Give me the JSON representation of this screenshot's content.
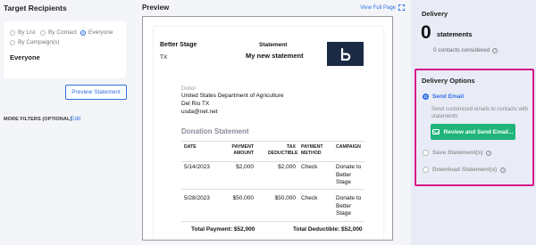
{
  "left": {
    "title": "Target Recipients",
    "radios": [
      {
        "label": "By List",
        "selected": false
      },
      {
        "label": "By Contact",
        "selected": false
      },
      {
        "label": "Everyone",
        "selected": true
      },
      {
        "label": "By Campaign(s)",
        "selected": false
      }
    ],
    "selected_value": "Everyone",
    "preview_button": "Preview Statement",
    "filters_label": "MORE FILTERS (OPTIONAL)",
    "filters_edit": "Edit"
  },
  "preview": {
    "title": "Preview",
    "view_full": "View Full Page",
    "org_name": "Better Stage",
    "org_state": "TX",
    "statement_label": "Statement",
    "statement_name": "My new statement",
    "logo_letter": "b",
    "donor_label": "Donor",
    "donor_lines": [
      "United States Department of Agriculture",
      "Del Rio TX",
      "usda@net.net"
    ],
    "donation_title": "Donation Statement",
    "columns": [
      [
        "DATE"
      ],
      [
        "PAYMENT",
        "AMOUNT"
      ],
      [
        "TAX",
        "DEDUCTIBLE"
      ],
      [
        "PAYMENT",
        "METHOD"
      ],
      [
        "CAMPAIGN"
      ]
    ],
    "rows": [
      {
        "date": "5/14/2023",
        "amount": "$2,000",
        "deductible": "$2,000",
        "method": "Check",
        "campaign": [
          "Donate to",
          "Better",
          "Stage"
        ]
      },
      {
        "date": "5/28/2023",
        "amount": "$50,000",
        "deductible": "$50,000",
        "method": "Check",
        "campaign": [
          "Donate to",
          "Better",
          "Stage"
        ]
      }
    ],
    "total_payment": "Total Payment: $52,000",
    "total_deductible": "Total Deductible: $52,000"
  },
  "delivery": {
    "title": "Delivery",
    "count": "0",
    "count_label": "statements",
    "contacts_line": "0 contacts considered",
    "options_title": "Delivery Options",
    "options": [
      {
        "label": "Send Email",
        "selected": true
      },
      {
        "label": "Save Statement(s)",
        "selected": false
      },
      {
        "label": "Download Statement(s)",
        "selected": false
      }
    ],
    "send_desc": "Send customized emails to contacts with statements",
    "review_button": "Review and Send Email...",
    "accent": "#2f6fe4",
    "highlight": "#d6188a",
    "button_color": "#1fb47a"
  }
}
